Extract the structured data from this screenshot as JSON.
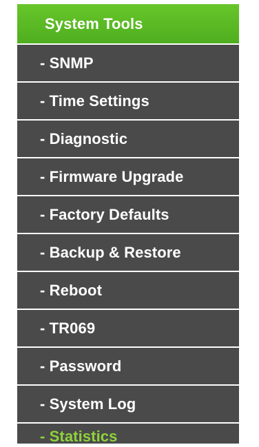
{
  "menu": {
    "section_title": "System Tools",
    "items": [
      {
        "label": "- SNMP"
      },
      {
        "label": "- Time Settings"
      },
      {
        "label": "- Diagnostic"
      },
      {
        "label": "- Firmware Upgrade"
      },
      {
        "label": "- Factory Defaults"
      },
      {
        "label": "- Backup & Restore"
      },
      {
        "label": "- Reboot"
      },
      {
        "label": "- TR069"
      },
      {
        "label": "- Password"
      },
      {
        "label": "- System Log"
      },
      {
        "label": "- Statistics"
      }
    ]
  },
  "colors": {
    "header_green": "#5dbd27",
    "item_bg": "#4a4a4a",
    "item_text": "#ffffff",
    "active_text": "#8fd23a"
  }
}
